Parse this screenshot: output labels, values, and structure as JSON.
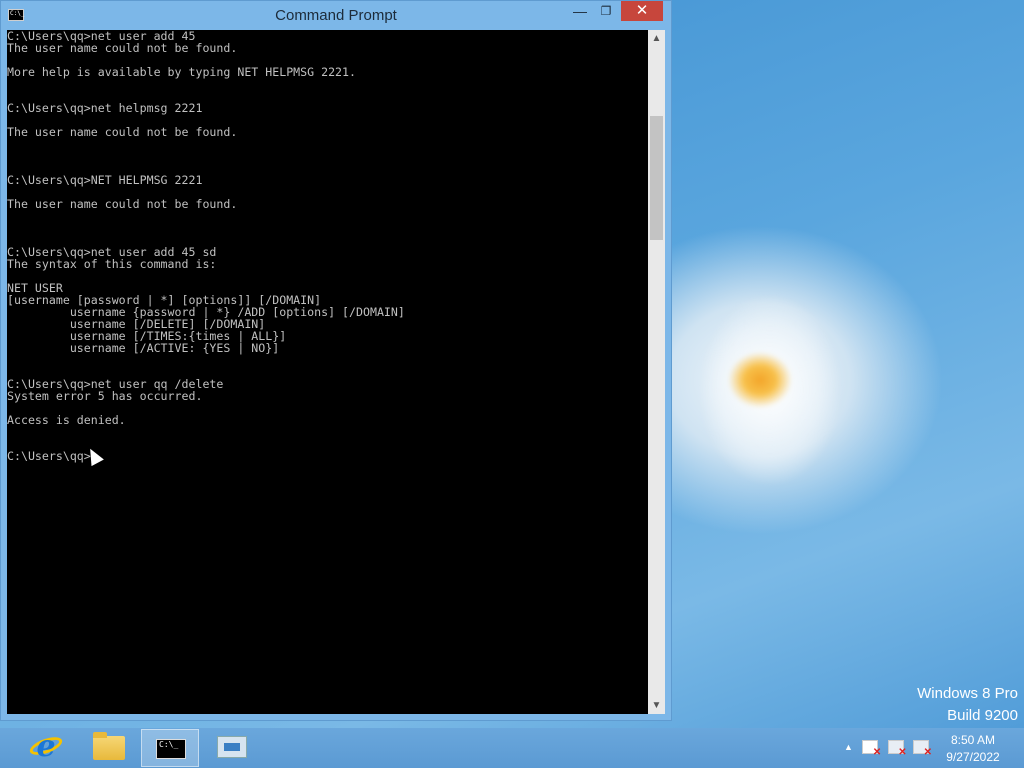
{
  "window": {
    "title": "Command Prompt",
    "icon_label": "C:\\_",
    "minimize_glyph": "—",
    "maximize_glyph": "❐",
    "close_glyph": "✕"
  },
  "console": {
    "text": "C:\\Users\\qq>net user add 45\nThe user name could not be found.\n\nMore help is available by typing NET HELPMSG 2221.\n\n\nC:\\Users\\qq>net helpmsg 2221\n\nThe user name could not be found.\n\n\n\nC:\\Users\\qq>NET HELPMSG 2221\n\nThe user name could not be found.\n\n\n\nC:\\Users\\qq>net user add 45 sd\nThe syntax of this command is:\n\nNET USER\n[username [password | *] [options]] [/DOMAIN]\n         username {password | *} /ADD [options] [/DOMAIN]\n         username [/DELETE] [/DOMAIN]\n         username [/TIMES:{times | ALL}]\n         username [/ACTIVE: {YES | NO}]\n\n\nC:\\Users\\qq>net user qq /delete\nSystem error 5 has occurred.\n\nAccess is denied.\n\n\nC:\\Users\\qq>"
  },
  "scrollbar": {
    "up_glyph": "▲",
    "down_glyph": "▼"
  },
  "desktop": {
    "os_name": "Windows 8 Pro",
    "build": "Build 9200"
  },
  "taskbar": {
    "items": [
      {
        "name": "internet-explorer",
        "glyph": "e"
      },
      {
        "name": "file-explorer"
      },
      {
        "name": "command-prompt",
        "label": "C:\\_",
        "active": true
      },
      {
        "name": "network-app"
      }
    ],
    "tray": {
      "show_hidden_glyph": "▲"
    },
    "clock": {
      "time": "8:50 AM",
      "date": "9/27/2022"
    }
  }
}
